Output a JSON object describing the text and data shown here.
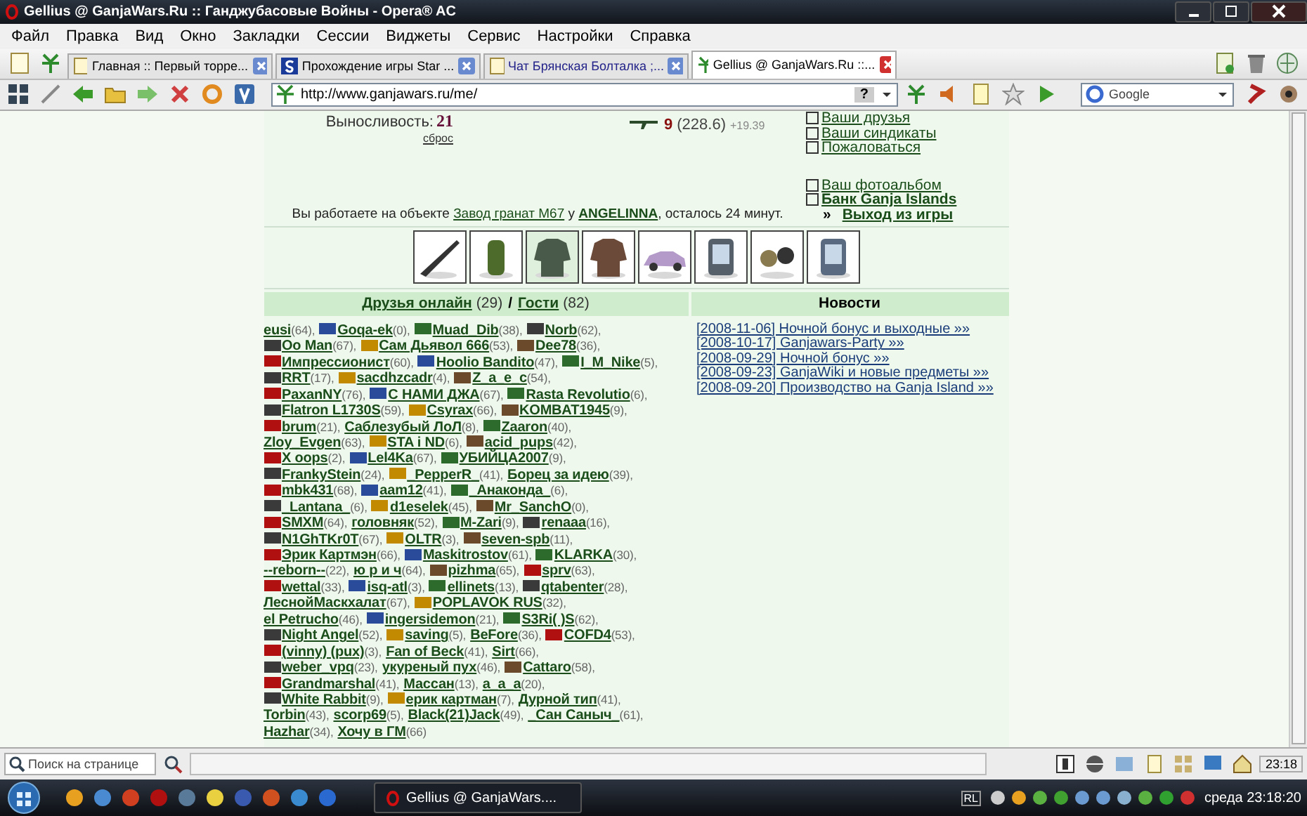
{
  "window": {
    "title": "Gellius @ GanjaWars.Ru :: Ганджубасовые Войны - Opera® AC"
  },
  "menu": [
    "Файл",
    "Правка",
    "Вид",
    "Окно",
    "Закладки",
    "Сессии",
    "Виджеты",
    "Сервис",
    "Настройки",
    "Справка"
  ],
  "tabs": [
    {
      "title": "Главная :: Первый торре...",
      "selected": false
    },
    {
      "title": "Прохождение игры Star ...",
      "selected": false
    },
    {
      "title": "Чат Брянская Болталка ;...",
      "selected": false
    },
    {
      "title": "Gellius @ GanjaWars.Ru ::...",
      "selected": true
    }
  ],
  "address": {
    "url": "http://www.ganjawars.ru/me/",
    "help": "?"
  },
  "search": {
    "engine": "Google"
  },
  "page": {
    "stat": {
      "label": "Выносливость:",
      "value": "21",
      "reset": "сброс"
    },
    "weapon": {
      "level": "9",
      "score": "(228.6)",
      "bonus": "+19.39"
    },
    "link_groups": [
      [
        {
          "text": "Ваши друзья",
          "bold": false
        },
        {
          "text": "Ваши синдикаты",
          "bold": false
        },
        {
          "text": "Пожаловаться",
          "bold": false
        }
      ],
      [
        {
          "text": "Ваш фотоальбом",
          "bold": false
        },
        {
          "text": "Банк Ganja Islands",
          "bold": true
        }
      ]
    ],
    "work": {
      "prefix": "Вы работаете на объекте",
      "object": "Завод гранат М67",
      "mid": "у",
      "owner": "ANGELINNA",
      "suffix": ", осталось 24 минут."
    },
    "exit": {
      "mark": "»",
      "text": "Выход из игры"
    },
    "items": [
      {
        "kind": "rifle",
        "selected": false
      },
      {
        "kind": "grenade",
        "selected": false
      },
      {
        "kind": "armor",
        "selected": true
      },
      {
        "kind": "coat",
        "selected": false
      },
      {
        "kind": "car",
        "selected": false
      },
      {
        "kind": "phone",
        "selected": false
      },
      {
        "kind": "binoculars",
        "selected": false
      },
      {
        "kind": "gps",
        "selected": false
      }
    ],
    "friends_header": {
      "friends": "Друзья онлайн",
      "friends_count": "(29)",
      "sep": "/",
      "guests": "Гости",
      "guests_count": "(82)"
    },
    "news": {
      "title": "Новости",
      "items": [
        "[2008-11-06] Ночной бонус и выходные »»",
        "[2008-10-17] Ganjawars-Party »»",
        "[2008-09-29] Ночной бонус »»",
        "[2008-09-23] GanjaWiki и новые предметы »»",
        "[2008-09-20] Производство на Ganja Island »»"
      ]
    },
    "friends": [
      [
        {
          "name": "eusi",
          "level": "(64),",
          "badge": false
        },
        {
          "name": "Goqa-ek",
          "level": "(0),",
          "badge": true
        },
        {
          "name": "Muad_Dib",
          "level": "(38),",
          "badge": true
        },
        {
          "name": "Norb",
          "level": "(62),",
          "badge": true
        }
      ],
      [
        {
          "name": "Oo Man",
          "level": "(67),",
          "badge": true
        },
        {
          "name": "Сам Дьявол 666",
          "level": "(53),",
          "badge": true
        },
        {
          "name": "Dee78",
          "level": "(36),",
          "badge": true
        }
      ],
      [
        {
          "name": "Импрессионист",
          "level": "(60),",
          "badge": true
        },
        {
          "name": "Hoolio Bandito",
          "level": "(47),",
          "badge": true
        },
        {
          "name": "I_M_Nike",
          "level": "(5),",
          "badge": true
        }
      ],
      [
        {
          "name": "RRT",
          "level": "(17),",
          "badge": true
        },
        {
          "name": "sacdhzcadr",
          "level": "(4),",
          "badge": true
        },
        {
          "name": "Z_a_e_c",
          "level": "(54),",
          "badge": true
        }
      ],
      [
        {
          "name": "PaxanNY",
          "level": "(76),",
          "badge": true
        },
        {
          "name": "С НАМИ ДЖА",
          "level": "(67),",
          "badge": true
        },
        {
          "name": "Rasta Revolutio",
          "level": "(6),",
          "badge": true
        }
      ],
      [
        {
          "name": "Flatron L1730S",
          "level": "(59),",
          "badge": true
        },
        {
          "name": "Csyrax",
          "level": "(66),",
          "badge": true
        },
        {
          "name": "KOMBAT1945",
          "level": "(9),",
          "badge": true
        }
      ],
      [
        {
          "name": "brum",
          "level": "(21),",
          "badge": true
        },
        {
          "name": "Саблезубый ЛоЛ",
          "level": "(8),",
          "badge": false
        },
        {
          "name": "Zaaron",
          "level": "(40),",
          "badge": true
        }
      ],
      [
        {
          "name": "Zloy_Evgen",
          "level": "(63),",
          "badge": false
        },
        {
          "name": "STA i ND",
          "level": "(6),",
          "badge": true
        },
        {
          "name": "acid_pups",
          "level": "(42),",
          "badge": true
        }
      ],
      [
        {
          "name": "X oops",
          "level": "(2),",
          "badge": true
        },
        {
          "name": "Lel4Ka",
          "level": "(67),",
          "badge": true
        },
        {
          "name": "УБИЙЦА2007",
          "level": "(9),",
          "badge": true
        }
      ],
      [
        {
          "name": "FrankyStein",
          "level": "(24),",
          "badge": true
        },
        {
          "name": "_PepperR_",
          "level": "(41),",
          "badge": true
        },
        {
          "name": "Борец за идею",
          "level": "(39),",
          "badge": false
        }
      ],
      [
        {
          "name": "mbk431",
          "level": "(68),",
          "badge": true
        },
        {
          "name": "aam12",
          "level": "(41),",
          "badge": true
        },
        {
          "name": "_Анаконда_",
          "level": "(6),",
          "badge": true
        }
      ],
      [
        {
          "name": "_Lantana_",
          "level": "(6),",
          "badge": true
        },
        {
          "name": "d1eselek",
          "level": "(45),",
          "badge": true
        },
        {
          "name": "Mr_SanchO",
          "level": "(0),",
          "badge": true
        }
      ],
      [
        {
          "name": "SMXM",
          "level": "(64),",
          "badge": true
        },
        {
          "name": "головняк",
          "level": "(52),",
          "badge": false
        },
        {
          "name": "M-Zari",
          "level": "(9),",
          "badge": true
        },
        {
          "name": "renaaa",
          "level": "(16),",
          "badge": true
        }
      ],
      [
        {
          "name": "N1GhTKr0T",
          "level": "(67),",
          "badge": true
        },
        {
          "name": "OLTR",
          "level": "(3),",
          "badge": true
        },
        {
          "name": "seven-spb",
          "level": "(11),",
          "badge": true
        }
      ],
      [
        {
          "name": "Эрик Картмэн",
          "level": "(66),",
          "badge": true
        },
        {
          "name": "Maskitrostov",
          "level": "(61),",
          "badge": true
        },
        {
          "name": "KLARKA",
          "level": "(30),",
          "badge": true
        }
      ],
      [
        {
          "name": "--reborn--",
          "level": "(22),",
          "badge": false
        },
        {
          "name": "ю р и ч",
          "level": "(64),",
          "badge": false
        },
        {
          "name": "pizhma",
          "level": "(65),",
          "badge": true
        },
        {
          "name": "sprv",
          "level": "(63),",
          "badge": true
        }
      ],
      [
        {
          "name": "wettal",
          "level": "(33),",
          "badge": true
        },
        {
          "name": "isq-atl",
          "level": "(3),",
          "badge": true
        },
        {
          "name": "ellinets",
          "level": "(13),",
          "badge": true
        },
        {
          "name": "qtabenter",
          "level": "(28),",
          "badge": true
        }
      ],
      [
        {
          "name": "ЛеснойМаскхалат",
          "level": "(67),",
          "badge": false
        },
        {
          "name": "POPLAVOK RUS",
          "level": "(32),",
          "badge": true
        }
      ],
      [
        {
          "name": "el Petrucho",
          "level": "(46),",
          "badge": false
        },
        {
          "name": "ingersidemon",
          "level": "(21),",
          "badge": true
        },
        {
          "name": "S3Ri( )S",
          "level": "(62),",
          "badge": true
        }
      ],
      [
        {
          "name": "Night Angel",
          "level": "(52),",
          "badge": true
        },
        {
          "name": "saving",
          "level": "(5),",
          "badge": true
        },
        {
          "name": "BeFore",
          "level": "(36),",
          "badge": false
        },
        {
          "name": "COFD4",
          "level": "(53),",
          "badge": true
        }
      ],
      [
        {
          "name": "(vinny) (pux)",
          "level": "(3),",
          "badge": true
        },
        {
          "name": "Fan of Beck",
          "level": "(41),",
          "badge": false
        },
        {
          "name": "Sirt",
          "level": "(66),",
          "badge": false
        }
      ],
      [
        {
          "name": "weber_vpq",
          "level": "(23),",
          "badge": true
        },
        {
          "name": "укуреный пух",
          "level": "(46),",
          "badge": false
        },
        {
          "name": "Cattaro",
          "level": "(58),",
          "badge": true
        }
      ],
      [
        {
          "name": "Grandmarshal",
          "level": "(41),",
          "badge": true
        },
        {
          "name": "Массан",
          "level": "(13),",
          "badge": false
        },
        {
          "name": "a_a_a",
          "level": "(20),",
          "badge": false
        }
      ],
      [
        {
          "name": "White Rabbit",
          "level": "(9),",
          "badge": true
        },
        {
          "name": "ерик картман",
          "level": "(7),",
          "badge": true
        },
        {
          "name": "Дурной тип",
          "level": "(41),",
          "badge": false
        }
      ],
      [
        {
          "name": "Torbin",
          "level": "(43),",
          "badge": false
        },
        {
          "name": "scorp69",
          "level": "(5),",
          "badge": false
        },
        {
          "name": "Black(21)Jack",
          "level": "(49),",
          "badge": false
        },
        {
          "name": "_Сан Саныч_",
          "level": "(61),",
          "badge": false
        }
      ],
      [
        {
          "name": "Hazhar",
          "level": "(34),",
          "badge": false
        },
        {
          "name": "Хочу в ГМ",
          "level": "(66)",
          "badge": false
        }
      ]
    ]
  },
  "find": {
    "placeholder": "Поиск на странице"
  },
  "status": {
    "clock": "23:18"
  },
  "taskbar": {
    "task": "Gellius @ GanjaWars....",
    "lang": "RL",
    "clock": "среда 23:18:20"
  }
}
